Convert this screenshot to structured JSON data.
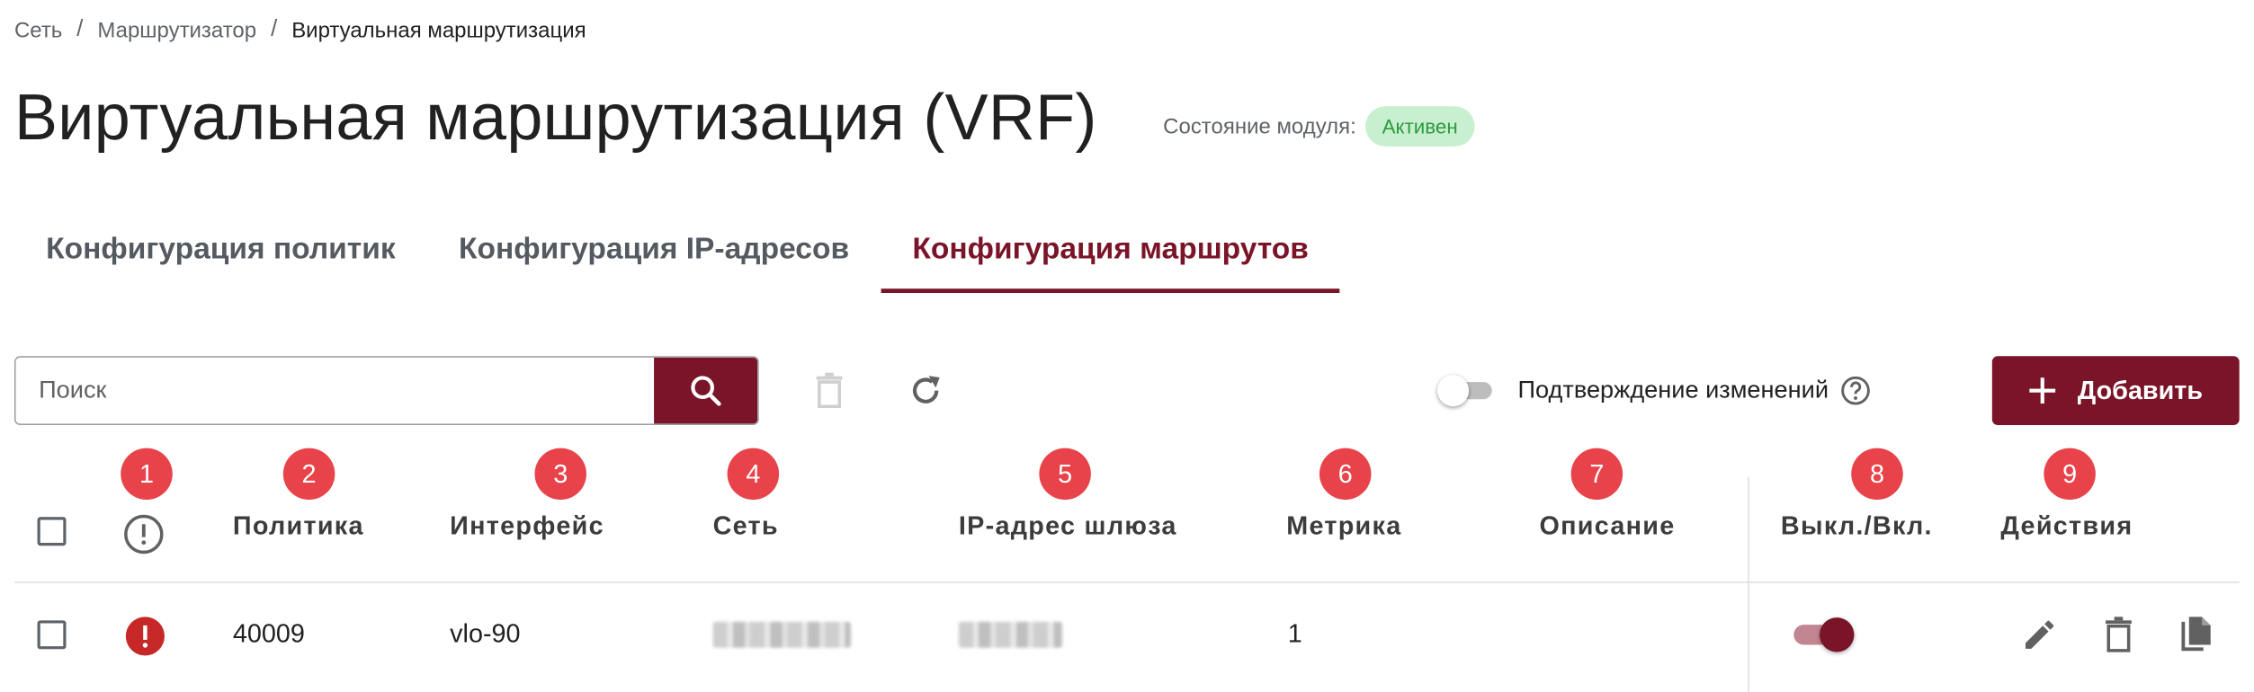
{
  "breadcrumb": {
    "items": [
      "Сеть",
      "Маршрутизатор"
    ],
    "current": "Виртуальная маршрутизация",
    "separator": "/"
  },
  "page": {
    "title": "Виртуальная маршрутизация (VRF)",
    "module_status_label": "Состояние модуля:",
    "module_status_value": "Активен"
  },
  "tabs": [
    {
      "label": "Конфигурация политик",
      "active": false
    },
    {
      "label": "Конфигурация IP-адресов",
      "active": false
    },
    {
      "label": "Конфигурация маршрутов",
      "active": true
    }
  ],
  "toolbar": {
    "search_placeholder": "Поиск",
    "confirm_changes_label": "Подтверждение изменений",
    "confirm_changes_enabled": false,
    "add_label": "Добавить"
  },
  "column_markers": [
    "1",
    "2",
    "3",
    "4",
    "5",
    "6",
    "7",
    "8",
    "9"
  ],
  "table": {
    "columns": [
      "Политика",
      "Интерфейс",
      "Сеть",
      "IP-адрес шлюза",
      "Метрика",
      "Описание",
      "Выкл./Вкл.",
      "Действия"
    ],
    "rows": [
      {
        "policy": "40009",
        "interface": "vlo-90",
        "network": "",
        "gateway": "",
        "metric": "1",
        "description": "",
        "enabled": true,
        "has_error": true
      }
    ]
  },
  "colors": {
    "accent": "#7a1428",
    "status_badge_bg": "#c8efcf",
    "status_badge_text": "#2e9a3f",
    "marker": "#e8434a",
    "error": "#c62828"
  },
  "icons": [
    "search-icon",
    "trash-icon",
    "refresh-icon",
    "help-icon",
    "plus-icon",
    "warning-circle-icon",
    "error-icon",
    "edit-icon",
    "delete-icon",
    "copy-icon"
  ]
}
